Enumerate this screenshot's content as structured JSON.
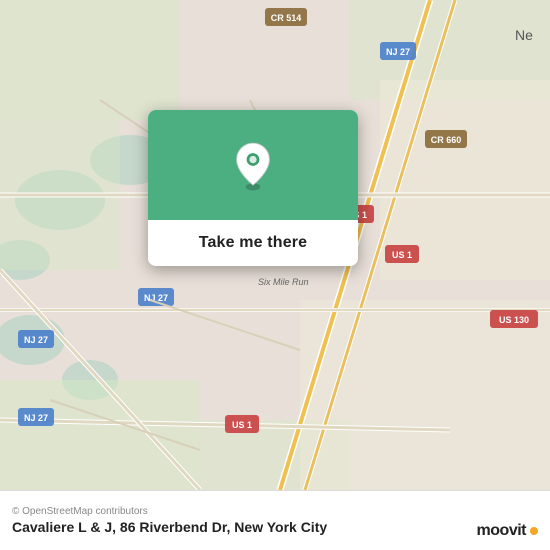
{
  "map": {
    "background_color": "#e8e0d8"
  },
  "card": {
    "button_label": "Take me there",
    "accent_color": "#3d9e6e"
  },
  "bottom_bar": {
    "attribution": "© OpenStreetMap contributors",
    "location_title": "Cavaliere L & J, 86 Riverbend Dr, New York City",
    "logo_text": "moovit"
  }
}
